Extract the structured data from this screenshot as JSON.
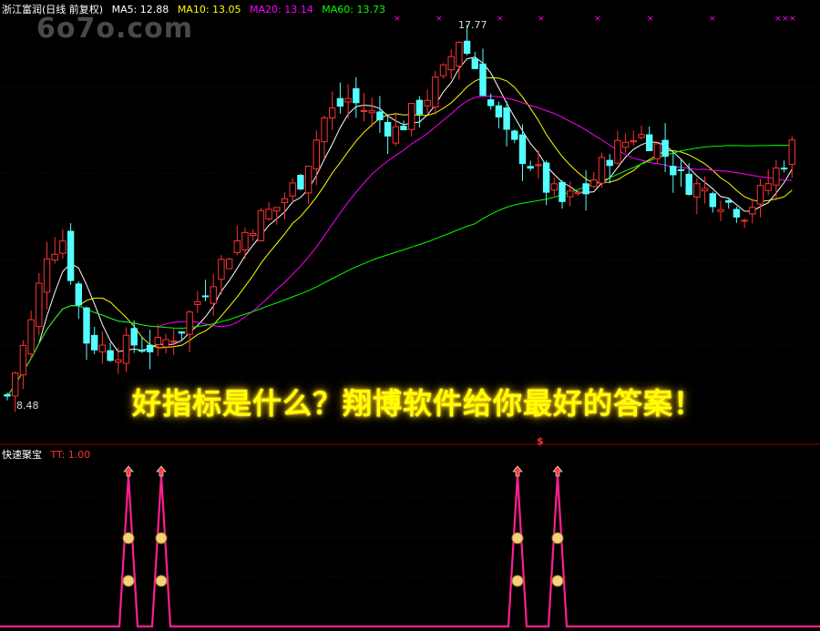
{
  "header": {
    "stock_title": "浙江富润(日线 前复权)",
    "ma5": "MA5: 12.88",
    "ma10": "MA10: 13.05",
    "ma20": "MA20: 13.14",
    "ma60": "MA60: 13.73"
  },
  "watermark": "6o7o.com",
  "annotations": {
    "high_label": "17.77",
    "low_label": "8.48"
  },
  "banner_text": "好指标是什么？翔博软件给你最好的答案！",
  "sub_panel": {
    "indicator_name": "快速聚宝",
    "tt_value": "TT: 1.00",
    "signal_marker": "$"
  },
  "colors": {
    "background": "#000000",
    "up_candle": "#ff3232",
    "down_candle": "#54ffff",
    "ma5": "#ffffff",
    "ma10": "#ffff00",
    "ma20": "#ff00ff",
    "ma60": "#00ff00",
    "signal_line": "#ff1f8f",
    "banner": "#ffff00"
  },
  "chart_data": [
    {
      "type": "candlestick",
      "title": "浙江富润(日线 前复权)",
      "series": [
        {
          "name": "MA5",
          "values": [
            12.88
          ]
        },
        {
          "name": "MA10",
          "values": [
            13.05
          ]
        },
        {
          "name": "MA20",
          "values": [
            13.14
          ]
        },
        {
          "name": "MA60",
          "values": [
            13.73
          ]
        }
      ],
      "annotations": {
        "max_price": 17.77,
        "min_price": 8.48
      },
      "grid": true
    },
    {
      "type": "line",
      "title": "快速聚宝",
      "series": [
        {
          "name": "TT",
          "values": [
            1.0
          ]
        }
      ],
      "signals": 4
    }
  ]
}
